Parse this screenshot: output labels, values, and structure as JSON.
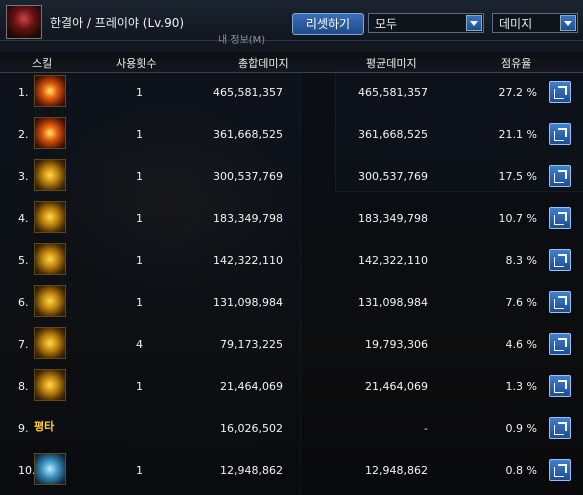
{
  "header": {
    "character": "한결아 / 프레이야 (Lv.90)",
    "sub_label": "내 정보(M)",
    "reset_button": "리셋하기",
    "filter_select": "모두",
    "metric_select": "데미지"
  },
  "table": {
    "columns": [
      "스킬",
      "사용횟수",
      "총합데미지",
      "평균데미지",
      "점유율"
    ],
    "rows": [
      {
        "rank": "1.",
        "icon": "fire-burst-skill-icon",
        "icon_label": "",
        "uses": "1",
        "total": "465,581,357",
        "avg": "465,581,357",
        "share": "27.2 %"
      },
      {
        "rank": "2.",
        "icon": "eye-orb-skill-icon",
        "icon_label": "",
        "uses": "1",
        "total": "361,668,525",
        "avg": "361,668,525",
        "share": "21.1 %"
      },
      {
        "rank": "3.",
        "icon": "light-spear-skill-icon",
        "icon_label": "",
        "uses": "1",
        "total": "300,537,769",
        "avg": "300,537,769",
        "share": "17.5 %"
      },
      {
        "rank": "4.",
        "icon": "explosion-skill-icon",
        "icon_label": "",
        "uses": "1",
        "total": "183,349,798",
        "avg": "183,349,798",
        "share": "10.7 %"
      },
      {
        "rank": "5.",
        "icon": "fist-skill-icon",
        "icon_label": "",
        "uses": "1",
        "total": "142,322,110",
        "avg": "142,322,110",
        "share": "8.3 %"
      },
      {
        "rank": "6.",
        "icon": "crown-skill-icon",
        "icon_label": "",
        "uses": "1",
        "total": "131,098,984",
        "avg": "131,098,984",
        "share": "7.6 %"
      },
      {
        "rank": "7.",
        "icon": "punch-skill-icon",
        "icon_label": "",
        "uses": "4",
        "total": "79,173,225",
        "avg": "19,793,306",
        "share": "4.6 %"
      },
      {
        "rank": "8.",
        "icon": "spark-punch-skill-icon",
        "icon_label": "",
        "uses": "1",
        "total": "21,464,069",
        "avg": "21,464,069",
        "share": "1.3 %"
      },
      {
        "rank": "9.",
        "icon": "",
        "icon_label": "평타",
        "uses": "",
        "total": "16,026,502",
        "avg": "-",
        "share": "0.9 %"
      },
      {
        "rank": "10.",
        "icon": "ice-crystal-skill-icon",
        "icon_label": "",
        "uses": "1",
        "total": "12,948,862",
        "avg": "12,948,862",
        "share": "0.8 %"
      }
    ]
  }
}
